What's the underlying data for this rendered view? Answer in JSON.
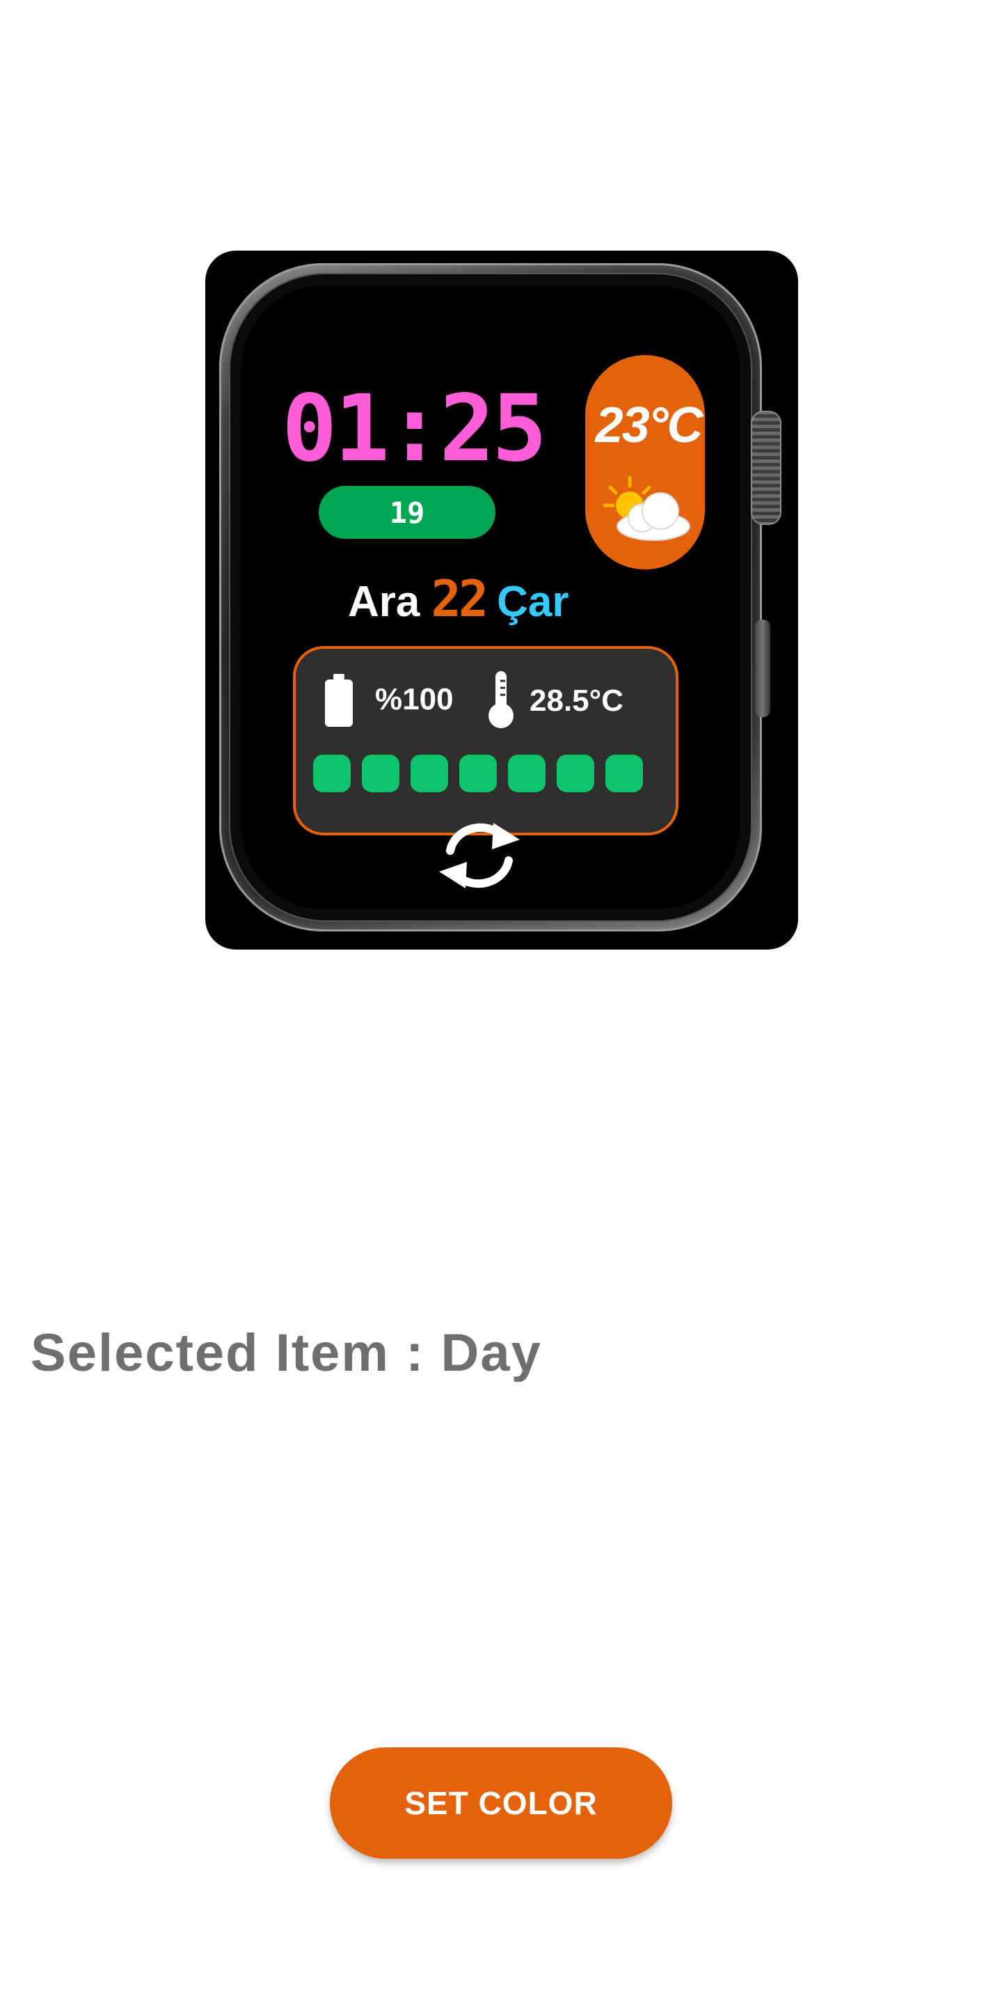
{
  "watch_preview": {
    "time": "01:25",
    "seconds": "19",
    "weather": {
      "temperature": "23°C",
      "icon": "partly-cloudy-icon"
    },
    "date": {
      "month": "Ara",
      "day": "22",
      "weekday": "Çar"
    },
    "battery": {
      "icon": "battery-icon",
      "value": "%100"
    },
    "device_temperature": {
      "icon": "thermometer-icon",
      "value": "28.5°C"
    },
    "week_progress_dots": 7,
    "refresh_icon": "refresh-icon"
  },
  "colors": {
    "time": "#ff5ed8",
    "seconds_pill": "#00a651",
    "accent_orange": "#e4620b",
    "weekday": "#34c9ff",
    "step_dot": "#0fc46b",
    "label_gray": "#6f6f6f"
  },
  "selection": {
    "label": "Selected Item : Day"
  },
  "actions": {
    "set_color_label": "SET COLOR"
  }
}
